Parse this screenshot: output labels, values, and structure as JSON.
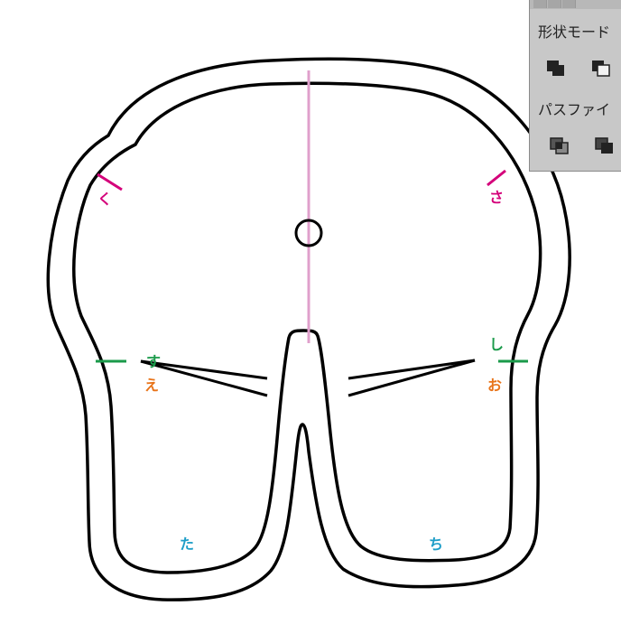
{
  "labels": {
    "ku": "く",
    "sa": "さ",
    "su": "す",
    "e": "え",
    "shi": "し",
    "o": "お",
    "ta": "た",
    "chi": "ち"
  },
  "colors": {
    "magenta": "#d4007a",
    "green": "#1a9a4a",
    "orange": "#e8741a",
    "cyan": "#1e9ec8",
    "guide": "#e0a0cc",
    "stroke": "#000000",
    "panel_bg": "#c8c8c8"
  },
  "pathfinder": {
    "shape_modes_title": "形状モード",
    "pathfinders_title": "パスファイ",
    "shape_mode_icons": [
      "unite-icon",
      "minus-front-icon"
    ],
    "pathfinder_icons": [
      "divide-icon",
      "trim-icon"
    ]
  }
}
